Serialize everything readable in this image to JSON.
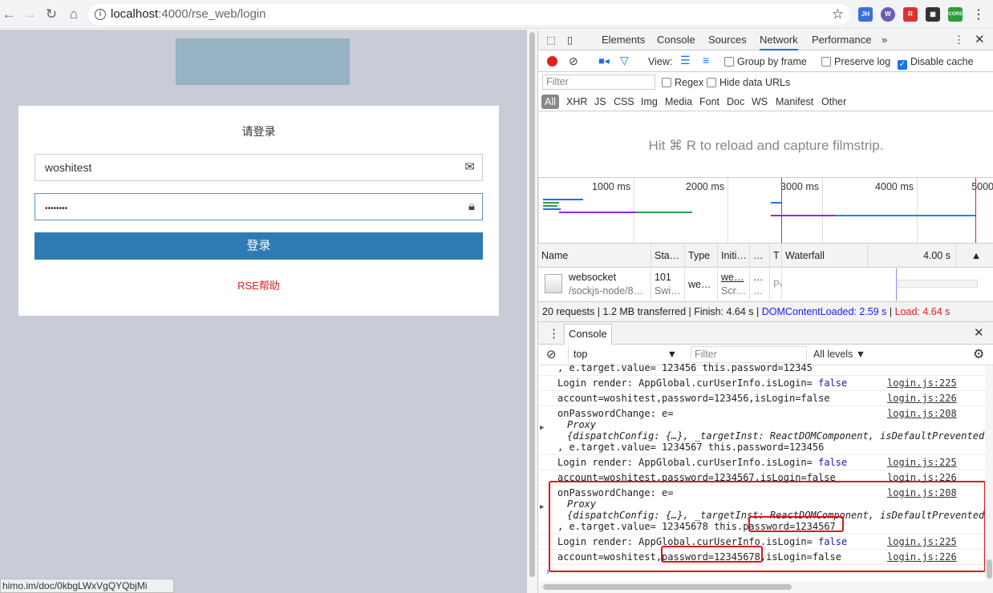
{
  "browser": {
    "url_host": "localhost",
    "url_path": ":4000/rse_web/login",
    "status_link": "himo.im/doc/0kbgLWxVgQYQbjMi",
    "extensions": [
      {
        "name": "JH",
        "color": "#3d6fd6"
      },
      {
        "name": "W",
        "color": "#6c5ab8"
      },
      {
        "name": "R",
        "color": "#d33"
      },
      {
        "name": "QR",
        "color": "#333"
      },
      {
        "name": "CORS",
        "color": "#2e9c3a"
      }
    ]
  },
  "login": {
    "title": "请登录",
    "username": "woshitest",
    "password_mask": "••••••••",
    "submit": "登录",
    "help": "RSE帮助"
  },
  "devtools": {
    "tabs": [
      "Elements",
      "Console",
      "Sources",
      "Network",
      "Performance"
    ],
    "active_tab": "Network",
    "more": "»",
    "network_toolbar": {
      "view_label": "View:",
      "group_by_frame": "Group by frame",
      "preserve_log": "Preserve log",
      "disable_cache": "Disable cache",
      "disable_cache_checked": true
    },
    "filter": {
      "placeholder": "Filter",
      "regex": "Regex",
      "hide_data_urls": "Hide data URLs"
    },
    "types": [
      "All",
      "XHR",
      "JS",
      "CSS",
      "Img",
      "Media",
      "Font",
      "Doc",
      "WS",
      "Manifest",
      "Other"
    ],
    "filmstrip_hint": "Hit ⌘ R to reload and capture filmstrip.",
    "timeline_ticks": [
      "1000 ms",
      "2000 ms",
      "3000 ms",
      "4000 ms",
      "5000"
    ],
    "table": {
      "headers": [
        "Name",
        "Sta…",
        "Type",
        "Initi…",
        "…",
        "T",
        "Waterfall",
        "4.00 s"
      ],
      "row": {
        "name": "websocket",
        "path": "/sockjs-node/8…",
        "status": "101",
        "status_text": "Swi…",
        "type": "we…",
        "initiator": "we…",
        "initiator_sub": "Scr…",
        "size": "…",
        "size_sub": "…",
        "time": "Pe"
      }
    },
    "summary": {
      "main": "20 requests | 1.2 MB transferred | Finish: 4.64 s | ",
      "dcl": "DOMContentLoaded: 2.59 s",
      "sep": " | ",
      "load": "Load: 4.64 s",
      "dcl_color": "#1a1aff",
      "load_color": "#e0201e"
    },
    "drawer_tab": "Console",
    "console_toolbar": {
      "context": "top",
      "filter_placeholder": "Filter",
      "levels": "All levels ▼"
    },
    "messages": [
      {
        "text": ", e.target.value= 123456 this.password=12345",
        "src": ""
      },
      {
        "text": "Login render: AppGlobal.curUserInfo.isLogin= ",
        "kw": "false",
        "src": "login.js:225"
      },
      {
        "text": "account=woshitest,password=123456,isLogin=false",
        "src": "login.js:226"
      },
      {
        "text": "onPasswordChange: e=",
        "proxy": "Proxy",
        "obj": "{dispatchConfig: {…}, _targetInst: ReactDOMComponent, isDefaultPrevented",
        "tail": ", e.target.value= 1234567 this.password=123456",
        "src": "login.js:208"
      },
      {
        "text": "Login render: AppGlobal.curUserInfo.isLogin= ",
        "kw": "false",
        "src": "login.js:225"
      },
      {
        "text": "account=woshitest,password=1234567,isLogin=false",
        "src": "login.js:226"
      },
      {
        "text": "onPasswordChange: e=",
        "proxy": "Proxy",
        "obj": "{dispatchConfig: {…}, _targetInst: ReactDOMComponent, isDefaultPrevented",
        "tail": ", e.target.value= 12345678 this.password=1234567",
        "src": "login.js:208"
      },
      {
        "text": "Login render: AppGlobal.curUserInfo.isLogin= ",
        "kw": "false",
        "src": "login.js:225"
      },
      {
        "text": "account=woshitest,password=12345678,isLogin=false",
        "src": "login.js:226"
      }
    ]
  }
}
